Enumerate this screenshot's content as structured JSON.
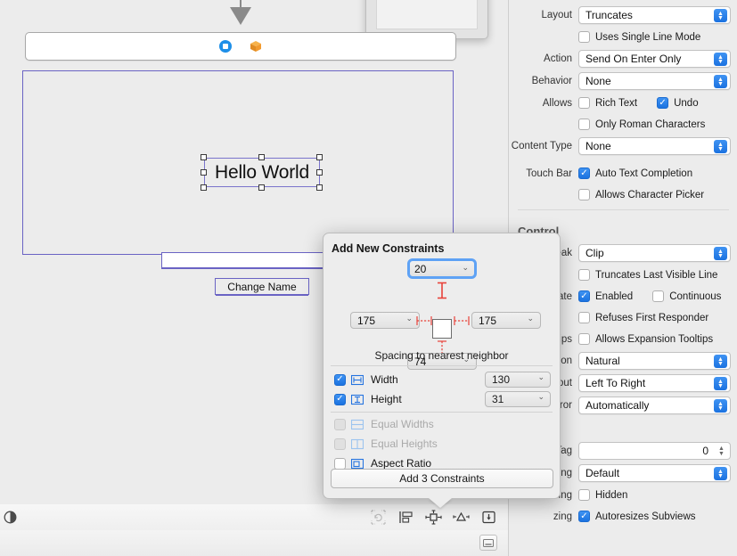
{
  "canvas": {
    "placard": {
      "window_icon": "window-icon",
      "first_responder_icon": "first-responder-cube-icon"
    },
    "connection_arrow_icon": "connection-arrow-icon",
    "design_view": {
      "label": "Hello World",
      "textfield_value": "",
      "button_label": "Change Name"
    }
  },
  "bottom_bar": {
    "appearance_icon": "appearance-contrast-icon",
    "tools": [
      {
        "name": "update-frames-icon",
        "label": "Update Frames",
        "enabled": false
      },
      {
        "name": "align-icon",
        "label": "Align",
        "enabled": true
      },
      {
        "name": "add-new-constraints-icon",
        "label": "Add New Constraints",
        "enabled": true
      },
      {
        "name": "resolve-auto-layout-issues-icon",
        "label": "Resolve Auto Layout Issues",
        "enabled": true
      },
      {
        "name": "embed-in-icon",
        "label": "Embed In",
        "enabled": true
      }
    ],
    "keyboard_icon": "keyboard-toggle-icon"
  },
  "inspector": {
    "rows": [
      {
        "label": "Layout",
        "value": "Truncates"
      },
      {
        "label": "Action",
        "value": "Send On Enter Only"
      },
      {
        "label": "Behavior",
        "value": "None"
      },
      {
        "label": "Content Type",
        "value": "None"
      }
    ],
    "uses_single_line_mode": {
      "label": "Uses Single Line Mode",
      "checked": false
    },
    "allows_label": "Allows",
    "allows": [
      {
        "label": "Rich Text",
        "checked": false
      },
      {
        "label": "Undo",
        "checked": true
      },
      {
        "label": "Only Roman Characters",
        "checked": false
      }
    ],
    "touch_bar_label": "Touch Bar",
    "touch_bar": [
      {
        "label": "Auto Text Completion",
        "checked": true
      },
      {
        "label": "Allows Character Picker",
        "checked": false
      }
    ],
    "control_section_title": "Control",
    "line_break": {
      "label": "Line Break",
      "value": "Clip"
    },
    "truncates_last_visible_line": {
      "label": "Truncates Last Visible Line",
      "checked": false
    },
    "state": {
      "label": "tate",
      "enabled": {
        "label": "Enabled",
        "checked": true
      },
      "continuous": {
        "label": "Continuous",
        "checked": false
      },
      "refuses_first_responder": {
        "label": "Refuses First Responder",
        "checked": false
      }
    },
    "tooltips": {
      "label": "ltips",
      "option": "Allows Expansion Tooltips",
      "checked": false
    },
    "direction_rows": [
      {
        "label": "tion",
        "value": "Natural"
      },
      {
        "label": "yout",
        "value": "Left To Right"
      },
      {
        "label": "irror",
        "value": "Automatically"
      }
    ],
    "tag": {
      "label": "Tag",
      "value": "0"
    },
    "focus_ring": {
      "label": "Ring",
      "value": "Default"
    },
    "drawing": {
      "label": "wing",
      "option": "Hidden",
      "checked": false
    },
    "resizing": {
      "label": "zing",
      "option": "Autoresizes Subviews",
      "checked": true
    }
  },
  "popover": {
    "title": "Add New Constraints",
    "spacing": {
      "top": "20",
      "leading": "175",
      "trailing": "175",
      "bottom": "74",
      "note": "Spacing to nearest neighbor"
    },
    "size_constraints": [
      {
        "name": "width",
        "label": "Width",
        "checked": true,
        "value": "130",
        "icon": "width-constraint-icon"
      },
      {
        "name": "height",
        "label": "Height",
        "checked": true,
        "value": "31",
        "icon": "height-constraint-icon"
      }
    ],
    "relation_constraints": [
      {
        "name": "equal-widths",
        "label": "Equal Widths",
        "checked": false,
        "disabled": true,
        "icon": "equal-widths-icon"
      },
      {
        "name": "equal-heights",
        "label": "Equal Heights",
        "checked": false,
        "disabled": true,
        "icon": "equal-heights-icon"
      },
      {
        "name": "aspect-ratio",
        "label": "Aspect Ratio",
        "checked": false,
        "disabled": false,
        "icon": "aspect-ratio-icon"
      }
    ],
    "add_button_label": "Add 3 Constraints"
  },
  "colors": {
    "accent_blue": "#2574e0",
    "focus_blue": "#5ea2f5",
    "strut_red": "#e8423a",
    "selection_purple": "#6a63c4",
    "cube_orange": "#f0962a",
    "panel_bg": "#ececec"
  }
}
